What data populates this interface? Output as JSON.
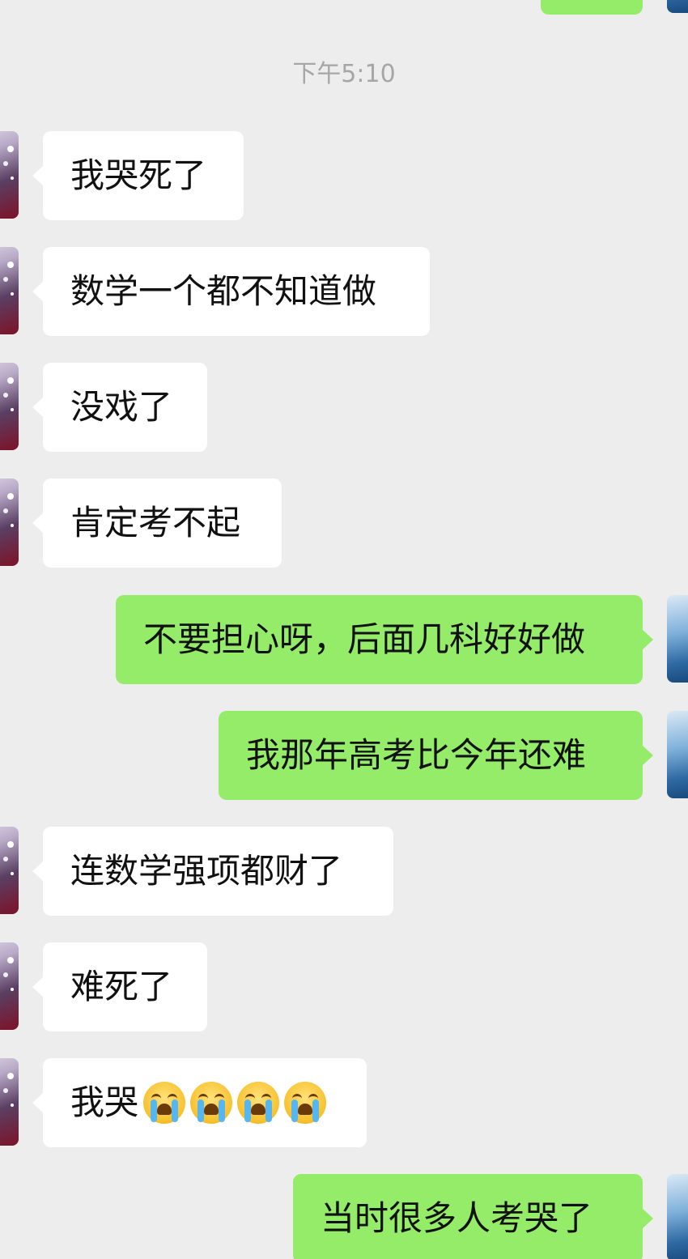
{
  "timestamp": "下午5:10",
  "messages": [
    {
      "side": "in",
      "text": "我哭死了"
    },
    {
      "side": "in",
      "text": "数学一个都不知道做"
    },
    {
      "side": "in",
      "text": "没戏了"
    },
    {
      "side": "in",
      "text": "肯定考不起"
    },
    {
      "side": "out",
      "text": "不要担心呀，后面几科好好做"
    },
    {
      "side": "out",
      "text": "我那年高考比今年还难"
    },
    {
      "side": "in",
      "text": "连数学强项都财了"
    },
    {
      "side": "in",
      "text": "难死了"
    },
    {
      "side": "in",
      "text": "我哭",
      "emoji": "loudly-crying-face-icon",
      "emoji_count": 4
    },
    {
      "side": "out",
      "text": "当时很多人考哭了"
    }
  ],
  "colors": {
    "background": "#ededed",
    "incoming_bubble": "#ffffff",
    "outgoing_bubble": "#95ec69",
    "timestamp_text": "#a6a6a6"
  }
}
